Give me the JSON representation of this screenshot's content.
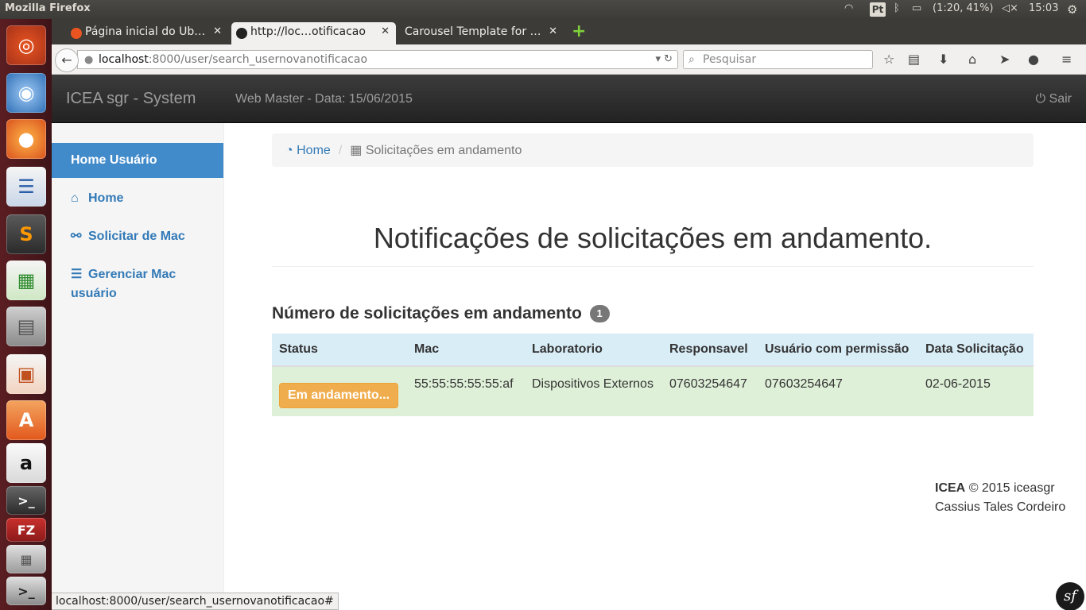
{
  "system_panel": {
    "app_title": "Mozilla Firefox",
    "keyboard_layout": "Pt",
    "battery_text": "(1:20, 41%)",
    "clock": "15:03"
  },
  "launcher": {
    "apps": [
      "Ubuntu Dash",
      "Chromium",
      "Firefox",
      "LibreOffice Writer",
      "Sublime Text",
      "LibreOffice Calc",
      "Files",
      "LibreOffice Impress",
      "Ubuntu Software Center",
      "Amazon",
      "Terminal",
      "FileZilla",
      "Workspaces",
      "Terminal"
    ]
  },
  "browser": {
    "tabs": [
      {
        "label": "Página inicial do Ub…",
        "active": false
      },
      {
        "label": "http://loc…otificacao",
        "active": true
      },
      {
        "label": "Carousel Template for …",
        "active": false
      }
    ],
    "url_host": "localhost",
    "url_path": ":8000/user/search_usernovanotificacao",
    "search_placeholder": "Pesquisar",
    "status_url": "localhost:8000/user/search_usernovanotificacao#"
  },
  "app_nav": {
    "brand": "ICEA sgr - System",
    "subtitle": "Web Master - Data: 15/06/2015",
    "logout_label": "Sair"
  },
  "sidebar": {
    "items": [
      {
        "label": "Home Usuário"
      },
      {
        "label": "Home"
      },
      {
        "label": "Solicitar de Mac"
      },
      {
        "label": "Gerenciar Mac usuário"
      }
    ]
  },
  "breadcrumb": {
    "home": "Home",
    "current": "Solicitações em andamento"
  },
  "page": {
    "title": "Notificações de solicitações em andamento.",
    "subheading": "Número de solicitações em andamento",
    "count_badge": "1"
  },
  "table": {
    "headers": [
      "Status",
      "Mac",
      "Laboratorio",
      "Responsavel",
      "Usuário com permissão",
      "Data Solicitação"
    ],
    "rows": [
      {
        "status": "Em andamento...",
        "mac": "55:55:55:55:55:af",
        "laboratorio": "Dispositivos Externos",
        "responsavel": "07603254647",
        "usuario": "07603254647",
        "data": "02-06-2015"
      }
    ]
  },
  "footer": {
    "org": "ICEA",
    "copyright": "© 2015 iceasgr",
    "author": "Cassius Tales Cordeiro"
  },
  "symfony_badge": "sf"
}
